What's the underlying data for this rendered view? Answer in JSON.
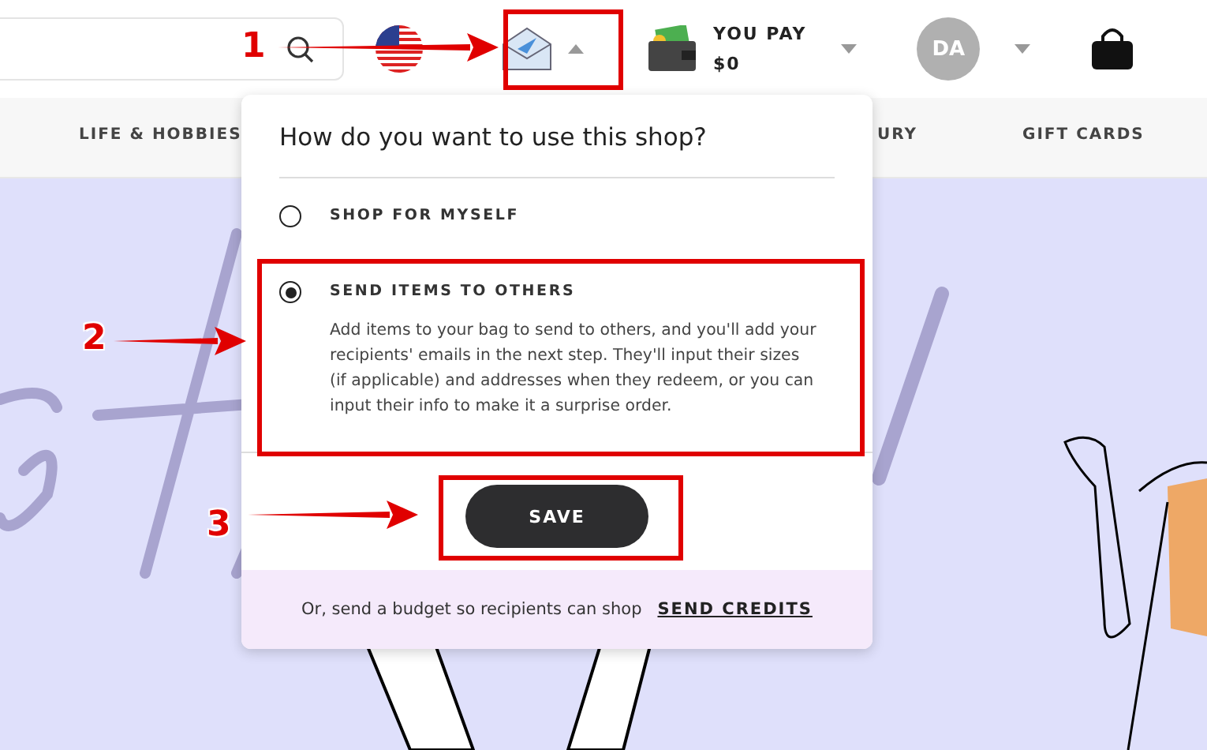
{
  "header": {
    "pay_label": "YOU PAY",
    "pay_amount": "$0",
    "avatar": "DA",
    "mode_menu": {
      "expanded": true
    }
  },
  "nav": [
    {
      "label": "LIFE & HOBBIES"
    },
    {
      "label": "URY"
    },
    {
      "label": "GIFT CARDS"
    }
  ],
  "popup": {
    "title": "How do you want to use this shop?",
    "options": [
      {
        "label": "SHOP FOR MYSELF",
        "selected": false
      },
      {
        "label": "SEND ITEMS TO OTHERS",
        "selected": true,
        "description": "Add items to your bag to send to others, and you'll add your recipients' emails in the next step. They'll input their sizes (if applicable) and addresses when they redeem, or you can input their info to make it a surprise order."
      }
    ],
    "save": "SAVE",
    "footer_text": "Or, send a budget so recipients can shop",
    "footer_link": "SEND CREDITS"
  },
  "annotations": [
    {
      "number": "1"
    },
    {
      "number": "2"
    },
    {
      "number": "3"
    }
  ]
}
